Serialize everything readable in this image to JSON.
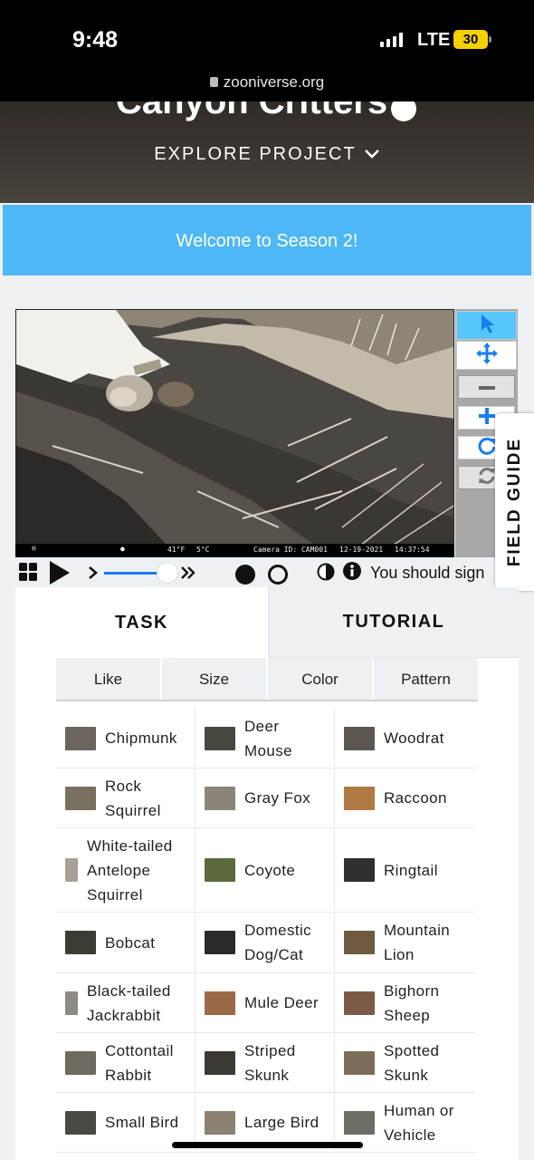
{
  "status_bar": {
    "time": "9:48",
    "network": "LTE",
    "battery": "30",
    "url": "zooniverse.org"
  },
  "project": {
    "title": "Canyon Critters",
    "explore_label": "EXPLORE PROJECT"
  },
  "banner": {
    "text": "Welcome to Season 2!"
  },
  "camera_strip": {
    "temp_f": "41°F",
    "temp_c": "5°C",
    "camera_id": "Camera ID: CAM001",
    "date": "12-19-2021",
    "time": "14:37:54"
  },
  "icons": {
    "pointer": "pointer-icon",
    "move": "move-icon",
    "zoom_out": "zoom-out-icon",
    "zoom_in": "zoom-in-icon",
    "rotate": "rotate-icon",
    "reset": "reset-icon",
    "grid": "grid-icon",
    "play": "play-icon",
    "invert": "invert-icon",
    "info": "info-icon"
  },
  "colors": {
    "banner": "#4db8f5",
    "tool_active": "#56c6fb",
    "slider": "#1a7cf0",
    "toolbar_icon": "#1a7cf0"
  },
  "player": {
    "slider_position": 0.8
  },
  "field_guide": {
    "label": "FIELD GUIDE"
  },
  "notice": {
    "text": "You should sign"
  },
  "tabs": {
    "task": "TASK",
    "tutorial": "TUTORIAL"
  },
  "filters": [
    "Like",
    "Size",
    "Color",
    "Pattern"
  ],
  "species": [
    [
      {
        "lines": [
          "Chipmunk"
        ]
      },
      {
        "lines": [
          "Deer",
          "Mouse"
        ]
      },
      {
        "lines": [
          "Woodrat"
        ]
      }
    ],
    [
      {
        "lines": [
          "Rock",
          "Squirrel"
        ]
      },
      {
        "lines": [
          "Gray Fox"
        ]
      },
      {
        "lines": [
          "Raccoon"
        ]
      }
    ],
    [
      {
        "lines": [
          "White-tailed",
          "Antelope",
          "Squirrel"
        ]
      },
      {
        "lines": [
          "Coyote"
        ]
      },
      {
        "lines": [
          "Ringtail"
        ]
      }
    ],
    [
      {
        "lines": [
          "Bobcat"
        ]
      },
      {
        "lines": [
          "Domestic",
          "Dog/Cat"
        ]
      },
      {
        "lines": [
          "Mountain",
          "Lion"
        ]
      }
    ],
    [
      {
        "lines": [
          "Black-tailed",
          "Jackrabbit"
        ]
      },
      {
        "lines": [
          "Mule Deer"
        ]
      },
      {
        "lines": [
          "Bighorn",
          "Sheep"
        ]
      }
    ],
    [
      {
        "lines": [
          "Cottontail",
          "Rabbit"
        ]
      },
      {
        "lines": [
          "Striped",
          "Skunk"
        ]
      },
      {
        "lines": [
          "Spotted",
          "Skunk"
        ]
      }
    ],
    [
      {
        "lines": [
          "Small Bird"
        ]
      },
      {
        "lines": [
          "Large Bird"
        ]
      },
      {
        "lines": [
          "Human or",
          "Vehicle"
        ]
      }
    ]
  ]
}
